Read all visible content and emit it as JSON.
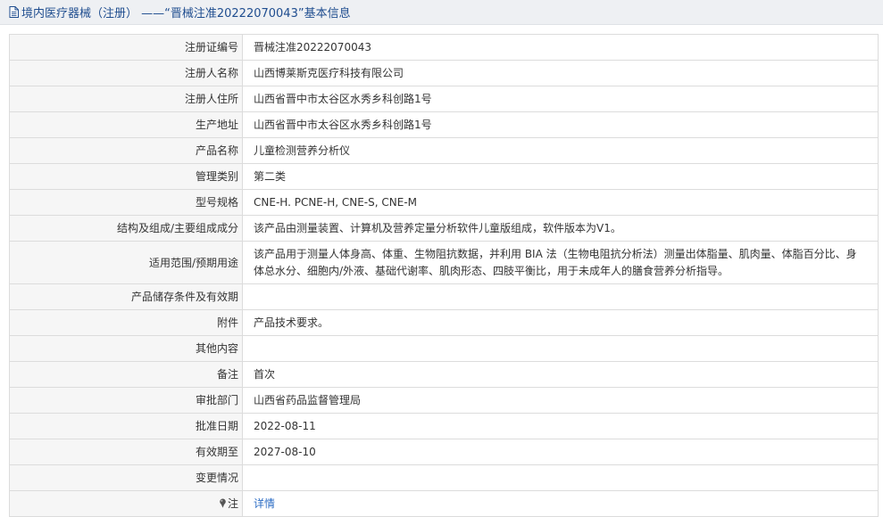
{
  "header": {
    "title": "境内医疗器械（注册） ——“晋械注准20222070043”基本信息",
    "icon": "document-icon"
  },
  "fields": [
    {
      "label": "注册证编号",
      "value": "晋械注准20222070043"
    },
    {
      "label": "注册人名称",
      "value": "山西博莱斯克医疗科技有限公司"
    },
    {
      "label": "注册人住所",
      "value": "山西省晋中市太谷区水秀乡科创路1号"
    },
    {
      "label": "生产地址",
      "value": "山西省晋中市太谷区水秀乡科创路1号"
    },
    {
      "label": "产品名称",
      "value": "儿童检测营养分析仪"
    },
    {
      "label": "管理类别",
      "value": "第二类"
    },
    {
      "label": "型号规格",
      "value": "CNE-H. PCNE-H, CNE-S, CNE-M"
    },
    {
      "label": "结构及组成/主要组成成分",
      "value": "该产品由测量装置、计算机及营养定量分析软件儿童版组成，软件版本为V1。"
    },
    {
      "label": "适用范围/预期用途",
      "value": "该产品用于测量人体身高、体重、生物阻抗数据，并利用 BIA 法（生物电阻抗分析法）测量出体脂量、肌肉量、体脂百分比、身体总水分、细胞内/外液、基础代谢率、肌肉形态、四肢平衡比，用于未成年人的膳食营养分析指导。"
    },
    {
      "label": "产品储存条件及有效期",
      "value": ""
    },
    {
      "label": "附件",
      "value": "产品技术要求。"
    },
    {
      "label": "其他内容",
      "value": ""
    },
    {
      "label": "备注",
      "value": "首次"
    },
    {
      "label": "审批部门",
      "value": "山西省药品监督管理局"
    },
    {
      "label": "批准日期",
      "value": "2022-08-11"
    },
    {
      "label": "有效期至",
      "value": "2027-08-10"
    },
    {
      "label": "变更情况",
      "value": ""
    }
  ],
  "note": {
    "label": "注",
    "link_text": "详情",
    "icon": "pin-icon"
  },
  "colors": {
    "title_text": "#1f4d8f",
    "title_bg": "#eef0f3",
    "label_bg": "#f6f6f6",
    "border": "#dcdcdc",
    "link": "#2b6cc4"
  }
}
